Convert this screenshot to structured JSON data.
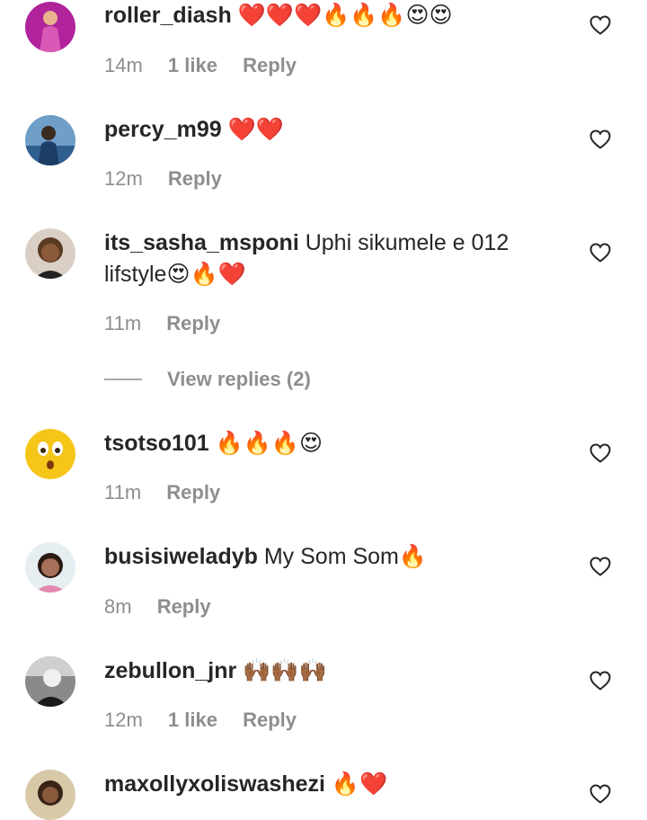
{
  "comments": [
    {
      "username": "roller_diash",
      "text": "",
      "emoji": "❤️❤️❤️🔥🔥🔥😍😍",
      "time": "14m",
      "likes": "1 like",
      "reply": "Reply"
    },
    {
      "username": "percy_m99",
      "text": "",
      "emoji": "❤️❤️",
      "time": "12m",
      "likes": "",
      "reply": "Reply"
    },
    {
      "username": "its_sasha_msponi",
      "text": "Uphi sikumele e 012 lifstyle",
      "emoji": "😍🔥❤️",
      "time": "11m",
      "likes": "",
      "reply": "Reply"
    },
    {
      "username": "tsotso101",
      "text": "",
      "emoji": "🔥🔥🔥😍",
      "time": "11m",
      "likes": "",
      "reply": "Reply"
    },
    {
      "username": "busisiweladyb",
      "text": "My Som Som",
      "emoji": "🔥",
      "time": "8m",
      "likes": "",
      "reply": "Reply"
    },
    {
      "username": "zebullon_jnr",
      "text": "",
      "emoji": "🙌🏾🙌🏾🙌🏾",
      "time": "12m",
      "likes": "1 like",
      "reply": "Reply"
    },
    {
      "username": "maxollyxoliswashezi",
      "text": "",
      "emoji": "🔥❤️",
      "time": "",
      "likes": "",
      "reply": ""
    }
  ],
  "view_replies": "View replies (2)",
  "icons": {
    "like": "heart-outline-icon"
  },
  "colors": {
    "text": "#262626",
    "muted": "#8e8e8e",
    "heart_emoji": "#e0245e",
    "fire_emoji": "#f7931e"
  }
}
